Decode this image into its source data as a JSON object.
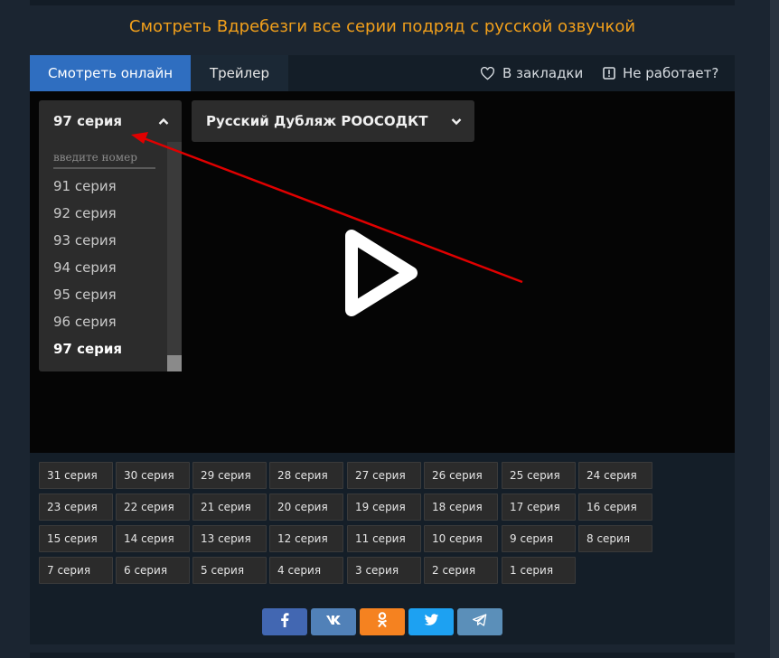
{
  "page": {
    "title": "Смотреть Вдребезги все серии подряд с русской озвучкой"
  },
  "tabs": {
    "watch_online": "Смотреть онлайн",
    "trailer": "Трейлер",
    "bookmarks": "В закладки",
    "not_working": "Не работает?"
  },
  "episode_select": {
    "current": "97 серия",
    "search_placeholder": "введите номер",
    "options": [
      "91 серия",
      "92 серия",
      "93 серия",
      "94 серия",
      "95 серия",
      "96 серия",
      "97 серия"
    ],
    "selected_index": 6
  },
  "voice_select": {
    "current": "Русский Дубляж РООСОДКТ"
  },
  "episodes": [
    "31 серия",
    "30 серия",
    "29 серия",
    "28 серия",
    "27 серия",
    "26 серия",
    "25 серия",
    "24 серия",
    "23 серия",
    "22 серия",
    "21 серия",
    "20 серия",
    "19 серия",
    "18 серия",
    "17 серия",
    "16 серия",
    "15 серия",
    "14 серия",
    "13 серия",
    "12 серия",
    "11 серия",
    "10 серия",
    "9 серия",
    "8 серия",
    "7 серия",
    "6 серия",
    "5 серия",
    "4 серия",
    "3 серия",
    "2 серия",
    "1 серия"
  ],
  "share": {
    "facebook": {
      "label": "f",
      "color": "#4267b2"
    },
    "vk": {
      "label": "vk",
      "color": "#5181b8"
    },
    "odnoklassniki": {
      "label": "ok",
      "color": "#f58220"
    },
    "twitter": {
      "label": "tw",
      "color": "#1da1f2"
    },
    "telegram": {
      "label": "tg",
      "color": "#5b8fb9"
    }
  },
  "colors": {
    "accent_title": "#f2a01b",
    "active_tab": "#2f6ec0",
    "annotation_arrow": "#e00000"
  }
}
